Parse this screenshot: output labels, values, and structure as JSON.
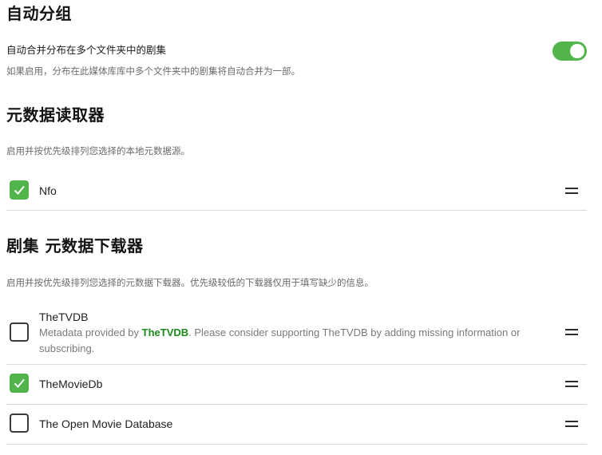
{
  "auto_group": {
    "title": "自动分组",
    "option_label": "自动合并分布在多个文件夹中的剧集",
    "option_desc": "如果启用，分布在此媒体库库中多个文件夹中的剧集将自动合并为一部。",
    "enabled": true
  },
  "metadata_readers": {
    "title": "元数据读取器",
    "desc": "启用并按优先级排列您选择的本地元数据源。",
    "items": [
      {
        "label": "Nfo",
        "checked": true
      }
    ]
  },
  "metadata_downloaders": {
    "title": "剧集 元数据下载器",
    "desc": "启用并按优先级排列您选择的元数据下载器。优先级较低的下载器仅用于填写缺少的信息。",
    "items": [
      {
        "label": "TheTVDB",
        "checked": false,
        "desc_prefix": "Metadata provided by ",
        "desc_brand": "TheTVDB",
        "desc_suffix": ". Please consider supporting TheTVDB by adding missing information or subscribing."
      },
      {
        "label": "TheMovieDb",
        "checked": true
      },
      {
        "label": "The Open Movie Database",
        "checked": false
      }
    ]
  },
  "colors": {
    "accent": "#52b54b",
    "brand_link": "#1c8a1c"
  },
  "icons": {
    "checkbox_checked": "checkmark-icon",
    "drag": "drag-handle-icon"
  }
}
